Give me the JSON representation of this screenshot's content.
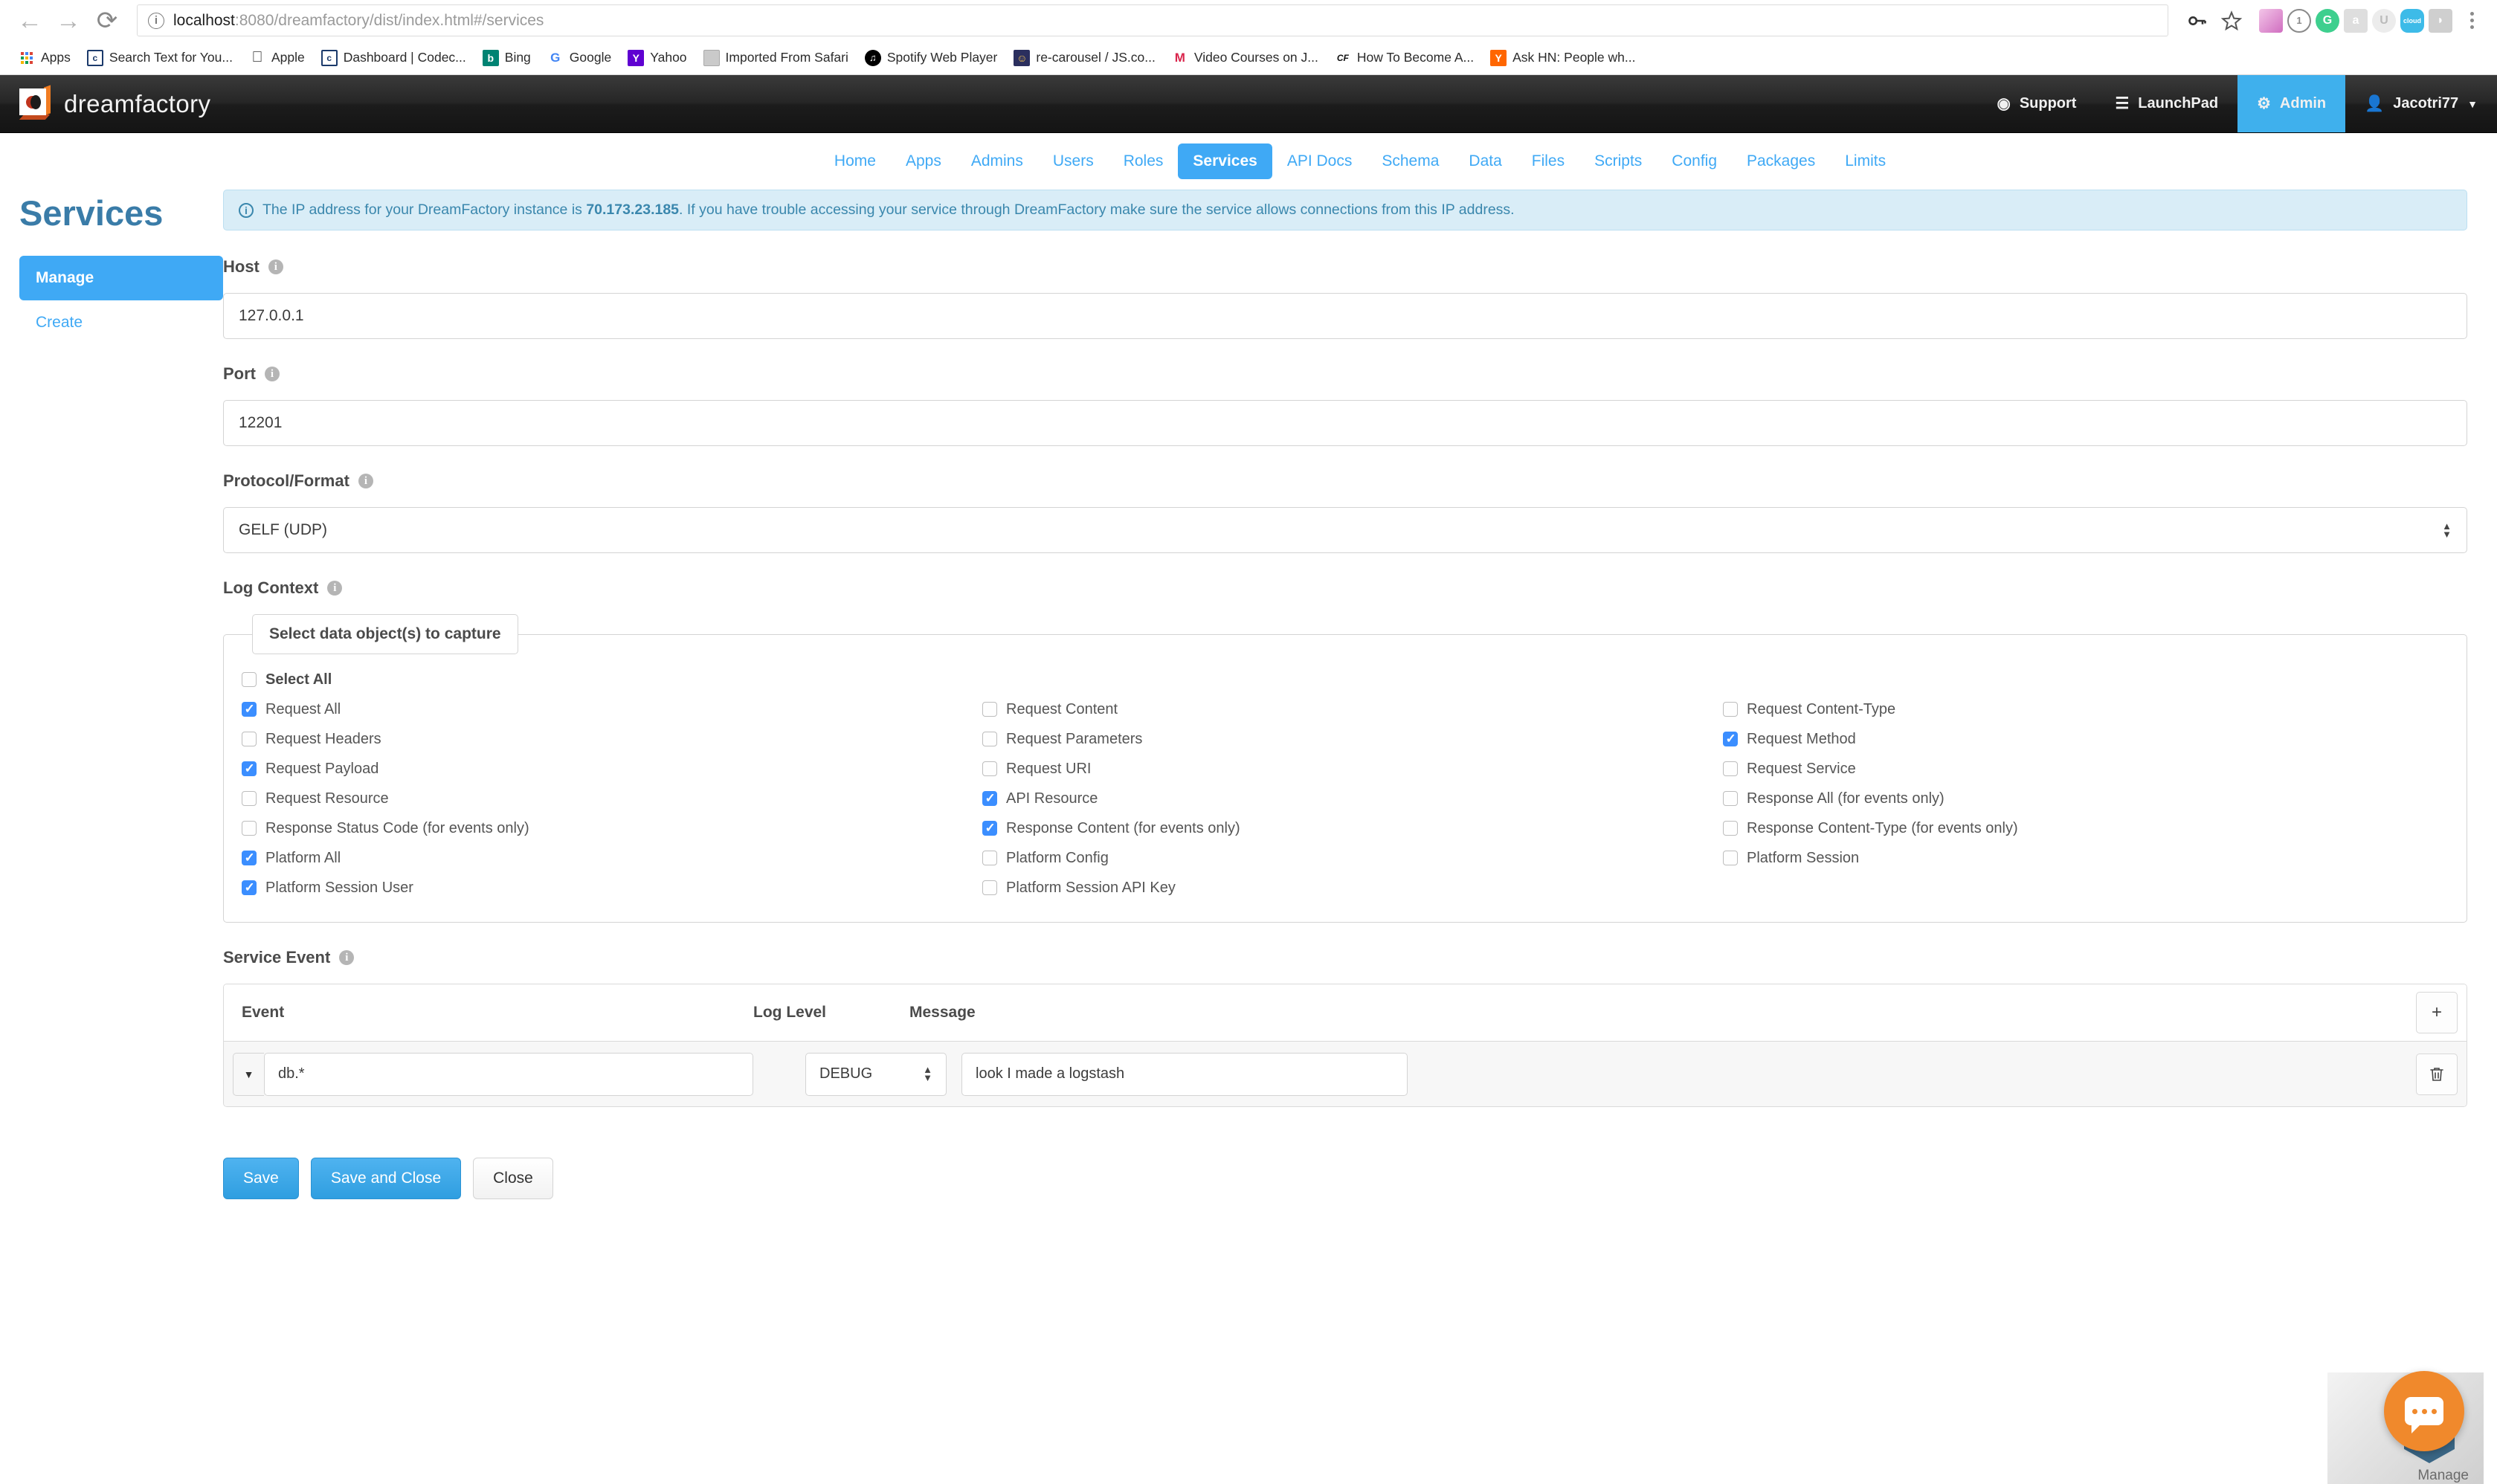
{
  "browser": {
    "url_prefix": "localhost",
    "url_suffix": ":8080/dreamfactory/dist/index.html#/services",
    "back_icon": "←",
    "forward_icon": "→",
    "reload_icon": "⟳",
    "site_info_icon": "info-icon",
    "key_icon": "key-icon",
    "star_icon": "star-icon",
    "bookmarks": [
      {
        "label": "Apps",
        "icon": "apps-grid-icon",
        "glyph": "",
        "bg": ""
      },
      {
        "label": "Search Text for You...",
        "icon": "codec-icon",
        "glyph": "c",
        "bg": "#ffffff",
        "fg": "#1b3a6b"
      },
      {
        "label": "Apple",
        "icon": "apple-icon",
        "glyph": "",
        "bg": "#ffffff",
        "fg": "#333333"
      },
      {
        "label": "Dashboard | Codec...",
        "icon": "codec-icon",
        "glyph": "c",
        "bg": "#ffffff",
        "fg": "#1b3a6b"
      },
      {
        "label": "Bing",
        "icon": "bing-icon",
        "glyph": "b",
        "bg": "#008373",
        "fg": "#ffffff"
      },
      {
        "label": "Google",
        "icon": "google-icon",
        "glyph": "G",
        "bg": "#ffffff",
        "fg": "#4285f4"
      },
      {
        "label": "Yahoo",
        "icon": "yahoo-icon",
        "glyph": "Y",
        "bg": "#5f01d1",
        "fg": "#ffffff"
      },
      {
        "label": "Imported From Safari",
        "icon": "folder-icon",
        "glyph": "",
        "bg": "#c9c9c9",
        "fg": "#8a8a8a"
      },
      {
        "label": "Spotify Web Player",
        "icon": "spotify-icon",
        "glyph": "♬",
        "bg": "#000000",
        "fg": "#ffffff"
      },
      {
        "label": "re-carousel / JS.co...",
        "icon": "avatar-icon",
        "glyph": "☻",
        "bg": "#2b2f5e",
        "fg": "#f5c451"
      },
      {
        "label": "Video Courses on J...",
        "icon": "m-icon",
        "glyph": "M",
        "bg": "#ffffff",
        "fg": "#d9254c"
      },
      {
        "label": "How To Become A...",
        "icon": "cf-icon",
        "glyph": "CF",
        "bg": "#ffffff",
        "fg": "#111111"
      },
      {
        "label": "Ask HN: People wh...",
        "icon": "hackernews-icon",
        "glyph": "Y",
        "bg": "#ff6600",
        "fg": "#ffffff"
      }
    ],
    "extensions": [
      {
        "name": "gradient-extension-icon",
        "glyph": "",
        "bg": "#e79ad6"
      },
      {
        "name": "onepassword-icon",
        "glyph": "1",
        "bg": "#8a8a8a"
      },
      {
        "name": "grammarly-icon",
        "glyph": "G",
        "bg": "#3ecf8e"
      },
      {
        "name": "quote-extension-icon",
        "glyph": "a",
        "bg": "#d6d6d6"
      },
      {
        "name": "u-extension-icon",
        "glyph": "U",
        "bg": "#dcdcdc"
      },
      {
        "name": "salesforce-icon",
        "glyph": "☁",
        "bg": "#3dbbe8"
      },
      {
        "name": "lastpass-icon",
        "glyph": "◗",
        "bg": "#bdbdbd"
      }
    ]
  },
  "app_header": {
    "brand": "dreamfactory",
    "support_label": "Support",
    "support_icon": "lifebuoy-icon",
    "launchpad_label": "LaunchPad",
    "launchpad_icon": "hamburger-icon",
    "admin_label": "Admin",
    "admin_icon": "gear-icon",
    "user_label": "Jacotri77",
    "user_icon": "user-icon",
    "caret_icon": "caret-down-icon",
    "accent_color": "#3fb0ed"
  },
  "page_nav": {
    "tabs": [
      {
        "label": "Home",
        "active": false
      },
      {
        "label": "Apps",
        "active": false
      },
      {
        "label": "Admins",
        "active": false
      },
      {
        "label": "Users",
        "active": false
      },
      {
        "label": "Roles",
        "active": false
      },
      {
        "label": "Services",
        "active": true
      },
      {
        "label": "API Docs",
        "active": false
      },
      {
        "label": "Schema",
        "active": false
      },
      {
        "label": "Data",
        "active": false
      },
      {
        "label": "Files",
        "active": false
      },
      {
        "label": "Scripts",
        "active": false
      },
      {
        "label": "Config",
        "active": false
      },
      {
        "label": "Packages",
        "active": false
      },
      {
        "label": "Limits",
        "active": false
      }
    ]
  },
  "sidebar": {
    "title": "Services",
    "items": [
      {
        "label": "Manage",
        "active": true
      },
      {
        "label": "Create",
        "active": false
      }
    ]
  },
  "alert": {
    "icon": "info-icon",
    "text_before": "The IP address for your DreamFactory instance is ",
    "ip": "70.173.23.185",
    "text_after": ". If you have trouble accessing your service through DreamFactory make sure the service allows connections from this IP address."
  },
  "form": {
    "host": {
      "label": "Host",
      "value": "127.0.0.1",
      "info_icon": "info-icon"
    },
    "port": {
      "label": "Port",
      "value": "12201",
      "info_icon": "info-icon"
    },
    "protocol": {
      "label": "Protocol/Format",
      "value": "GELF (UDP)",
      "info_icon": "info-icon"
    },
    "log_context": {
      "label": "Log Context",
      "info_icon": "info-icon",
      "legend": "Select data object(s) to capture",
      "select_all": {
        "label": "Select All",
        "checked": false
      },
      "column1": [
        {
          "label": "Request All",
          "checked": true
        },
        {
          "label": "Request Headers",
          "checked": false
        },
        {
          "label": "Request Payload",
          "checked": true
        },
        {
          "label": "Request Resource",
          "checked": false
        },
        {
          "label": "Response Status Code (for events only)",
          "checked": false
        },
        {
          "label": "Platform All",
          "checked": true
        },
        {
          "label": "Platform Session User",
          "checked": true
        }
      ],
      "column2": [
        {
          "label": "Request Content",
          "checked": false
        },
        {
          "label": "Request Parameters",
          "checked": false
        },
        {
          "label": "Request URI",
          "checked": false
        },
        {
          "label": "API Resource",
          "checked": true
        },
        {
          "label": "Response Content (for events only)",
          "checked": true
        },
        {
          "label": "Platform Config",
          "checked": false
        },
        {
          "label": "Platform Session API Key",
          "checked": false
        }
      ],
      "column3": [
        {
          "label": "Request Content-Type",
          "checked": false
        },
        {
          "label": "Request Method",
          "checked": true
        },
        {
          "label": "Request Service",
          "checked": false
        },
        {
          "label": "Response All (for events only)",
          "checked": false
        },
        {
          "label": "Response Content-Type (for events only)",
          "checked": false
        },
        {
          "label": "Platform Session",
          "checked": false
        }
      ]
    },
    "service_event": {
      "label": "Service Event",
      "info_icon": "info-icon",
      "columns": [
        "Event",
        "Log Level",
        "Message"
      ],
      "add_icon": "plus-icon",
      "rows": [
        {
          "caret_icon": "caret-down-icon",
          "event": "db.*",
          "log_level": "DEBUG",
          "message": "look I made a logstash",
          "delete_icon": "trash-icon"
        }
      ]
    }
  },
  "actions": {
    "save": "Save",
    "save_and_close": "Save and Close",
    "close": "Close"
  },
  "chat_widget": {
    "icon": "chat-bubble-icon",
    "color": "#f0892c",
    "badge_label": "Manage"
  }
}
